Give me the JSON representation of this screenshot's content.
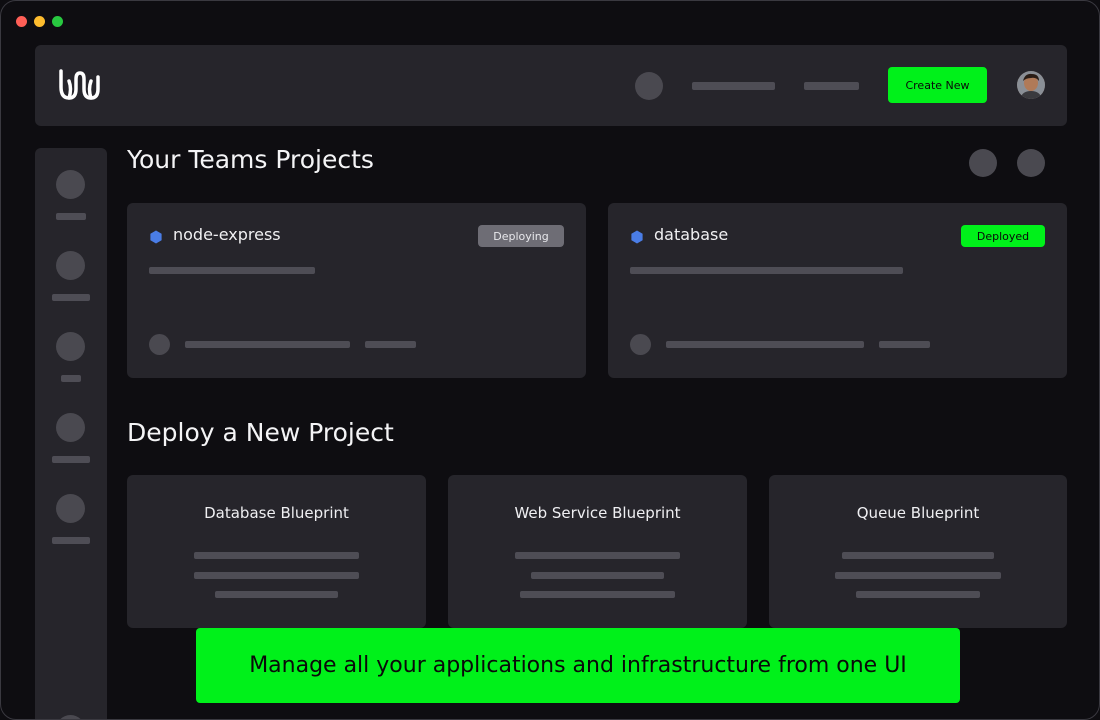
{
  "window": {
    "controls": [
      "close",
      "minimize",
      "maximize"
    ]
  },
  "header": {
    "logo": "logo-icon",
    "create_button_label": "Create New",
    "accent_color": "#00f11a"
  },
  "teams": {
    "title": "Your Teams Projects",
    "projects": [
      {
        "name": "node-express",
        "status": "Deploying"
      },
      {
        "name": "database",
        "status": "Deployed"
      }
    ]
  },
  "deploy": {
    "title": "Deploy a New Project",
    "blueprints": [
      {
        "label": "Database Blueprint"
      },
      {
        "label": "Web Service Blueprint"
      },
      {
        "label": "Queue Blueprint"
      }
    ]
  },
  "banner": {
    "text": "Manage all your applications and infrastructure from one UI"
  }
}
